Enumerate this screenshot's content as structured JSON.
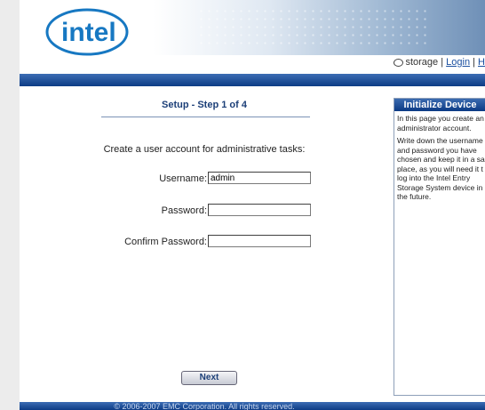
{
  "header": {
    "logo_text": "intel",
    "storage_label": "storage",
    "separator": "|",
    "login_link": "Login",
    "help_link": "H"
  },
  "setup": {
    "step_title": "Setup - Step 1 of 4",
    "instruction": "Create a user account for administrative tasks:",
    "username_label": "Username:",
    "username_value": "admin",
    "password_label": "Password:",
    "password_value": "",
    "confirm_label": "Confirm Password:",
    "confirm_value": "",
    "next_button": "Next"
  },
  "side_panel": {
    "title": "Initialize Device",
    "paragraph1": "In this page you create an\nadministrator account.",
    "paragraph2": "Write down the username\nand password you have\nchosen and keep it in a sa\nplace, as you will need it t\nlog into the Intel Entry\nStorage System device in\nthe future."
  },
  "footer": {
    "copyright": "© 2006-2007 EMC Corporation. All rights reserved."
  },
  "colors": {
    "navbar": "#1a4c96",
    "title_blue": "#1c3f78",
    "logo_blue": "#1778c2"
  }
}
